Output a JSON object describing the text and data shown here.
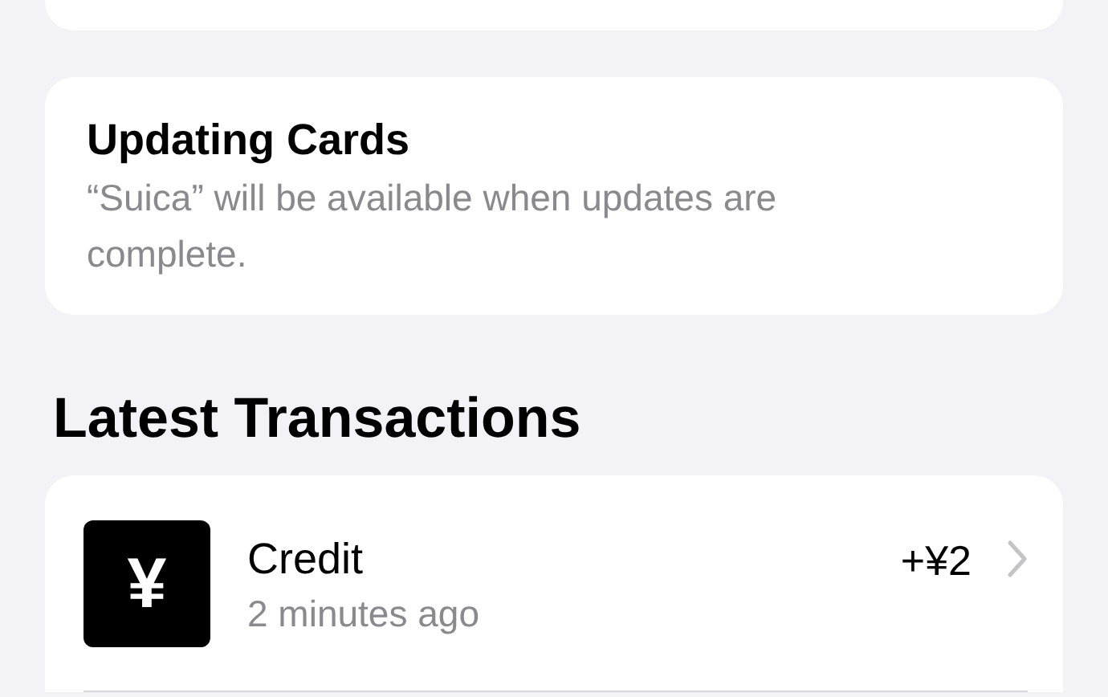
{
  "notice": {
    "title": "Updating Cards",
    "message": "“Suica” will be available when updates are complete."
  },
  "section_title": "Latest Transactions",
  "transactions": [
    {
      "icon": "¥",
      "title": "Credit",
      "time": "2 minutes ago",
      "amount": "+¥2"
    }
  ]
}
